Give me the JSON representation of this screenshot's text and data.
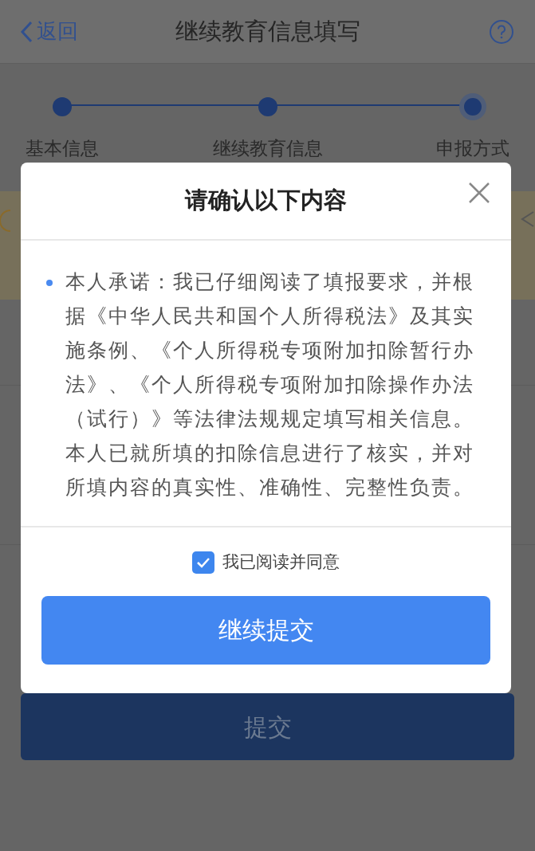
{
  "header": {
    "back": "返回",
    "title": "继续教育信息填写"
  },
  "steps": [
    {
      "label": "基本信息",
      "selected": false
    },
    {
      "label": "继续教育信息",
      "selected": false
    },
    {
      "label": "申报方式",
      "selected": true
    }
  ],
  "submit_button": "提交",
  "dialog": {
    "title": "请确认以下内容",
    "items": [
      "本人承诺：我已仔细阅读了填报要求，并根据《中华人民共和国个人所得税法》及其实施条例、《个人所得税专项附加扣除暂行办法》、《个人所得税专项附加扣除操作办法（试行）》等法律法规规定填写相关信息。本人已就所填的扣除信息进行了核实，并对所填内容的真实性、准确性、完整性负责。"
    ],
    "agree": {
      "label": "我已阅读并同意",
      "checked": true
    },
    "confirm_button": "继续提交"
  }
}
